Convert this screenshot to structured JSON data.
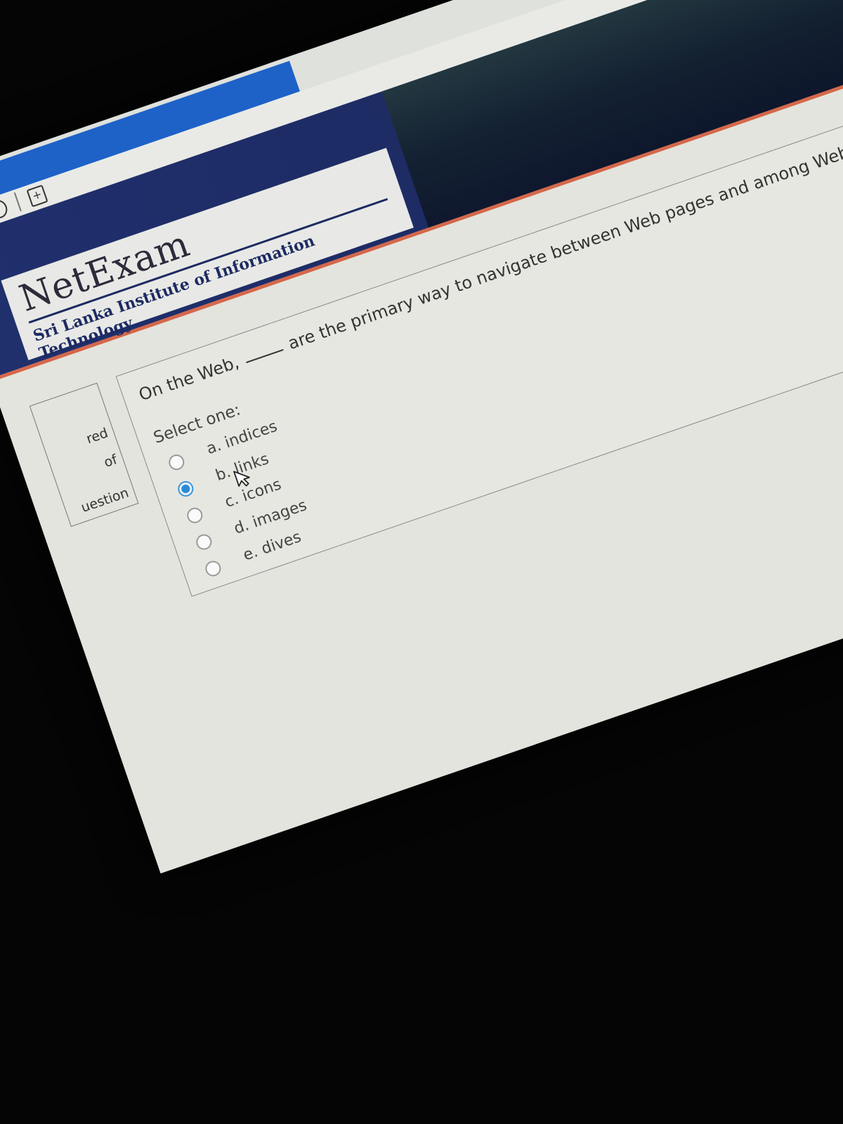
{
  "browser": {
    "new_tab_icon": "new-tab-icon",
    "back_icon": "back-icon"
  },
  "banner": {
    "logo_title": "NetExam",
    "logo_subtitle": "Sri Lanka Institute of Information Technology"
  },
  "info_block": {
    "line1": "red",
    "line2": "of",
    "line3": "uestion"
  },
  "question": {
    "text_before": "On the Web,",
    "text_after": "are the primary way to navigate between Web pages and among Web sites.",
    "select_label": "Select one:",
    "options": [
      {
        "label": "a. indices",
        "checked": false
      },
      {
        "label": "b. links",
        "checked": true
      },
      {
        "label": "c. icons",
        "checked": false
      },
      {
        "label": "d. images",
        "checked": false
      },
      {
        "label": "e. dives",
        "checked": false
      }
    ]
  },
  "colors": {
    "banner": "#1d2a62",
    "accent_rule": "#d5674a",
    "radio_selected": "#2c8ad4"
  }
}
